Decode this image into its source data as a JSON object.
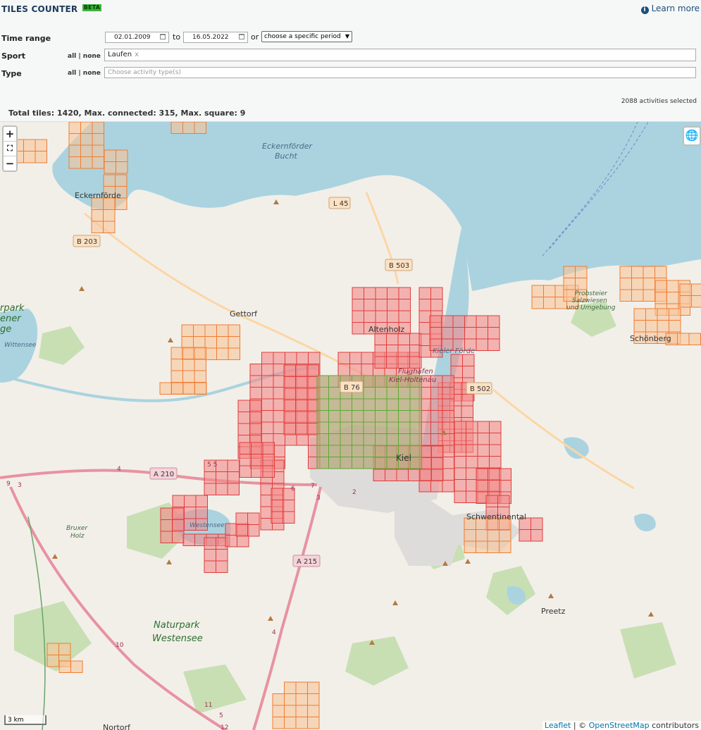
{
  "app": {
    "title": "TILES COUNTER",
    "beta": "BETA",
    "learn_more": "Learn more"
  },
  "form": {
    "time_range_label": "Time range",
    "date_from": "02.01.2009",
    "to_label": "to",
    "date_to": "16.05.2022",
    "or_label": "or",
    "period_select": "choose a specific period",
    "sport_label": "Sport",
    "sport_all_none": "all | none",
    "sport_value": "Laufen",
    "sport_remove": "x",
    "type_label": "Type",
    "type_all_none": "all | none",
    "type_placeholder": "Choose activity type(s)"
  },
  "summary": {
    "activities_selected": "2088 activities selected",
    "stats": "Total tiles: 1420, Max. connected: 315, Max. square: 9"
  },
  "map": {
    "zoom_in": "+",
    "fullscreen": "⛶",
    "zoom_out": "−",
    "layers_icon": "globe-icon",
    "scale": "3 km",
    "attribution_leaflet": "Leaflet",
    "attribution_sep": " | © ",
    "attribution_osm": "OpenStreetMap",
    "attribution_tail": " contributors",
    "colors": {
      "water": "#aad3df",
      "land": "#f2efe9",
      "forest": "#c8dfb4",
      "urban": "#dddcdb",
      "tile_red_fill": "#f28b8b",
      "tile_red_stroke": "#e03c3c",
      "tile_orange_fill": "#f8c49a",
      "tile_orange_stroke": "#f07c32",
      "tile_green_fill": "#b5a87a",
      "tile_green_stroke": "#5ea832"
    },
    "labels": {
      "eckernfoerde_bucht_1": "Eckernförder",
      "eckernfoerde_bucht_2": "Bucht",
      "eckernfoerde": "Eckernförde",
      "gettorf": "Gettorf",
      "altenholz": "Altenholz",
      "kieler_foerde": "Kieler Förde",
      "flughafen_1": "Flughafen",
      "flughafen_2": "Kiel-Holtenau",
      "kiel": "Kiel",
      "schwentinental": "Schwentinental",
      "schoenberg": "Schönberg",
      "probsteier_1": "Probsteier",
      "probsteier_2": "Salzwiesen",
      "probsteier_3": "und Umgebung",
      "preetz": "Preetz",
      "westensee": "Westensee",
      "bruxer_1": "Bruxer",
      "bruxer_2": "Holz",
      "naturpark_1": "Naturpark",
      "naturpark_2": "Westensee",
      "wittensee": "Wittensee",
      "naturpark_left_1": "rpark",
      "naturpark_left_2": "ener",
      "naturpark_left_3": "ge",
      "nortorf": "Nortorf"
    },
    "road_shields": {
      "l45": "L 45",
      "b203": "B 203",
      "b503": "B 503",
      "b76": "B 76",
      "b502": "B 502",
      "a210": "A 210",
      "a215": "A 215"
    },
    "road_numbers": {
      "a210_exit_4": "4",
      "a210_exit_5": "5 5",
      "a210_exit_6": "6",
      "a210_exit_7": "7",
      "a215_exit_2": "2",
      "a215_exit_3": "3",
      "a7_exit_9": "9",
      "a7_exit_3": "3",
      "a7_exit_10": "10",
      "a7_exit_4": "4",
      "a7_exit_11": "11",
      "a7_exit_5": "5",
      "a7_exit_12": "12"
    }
  }
}
